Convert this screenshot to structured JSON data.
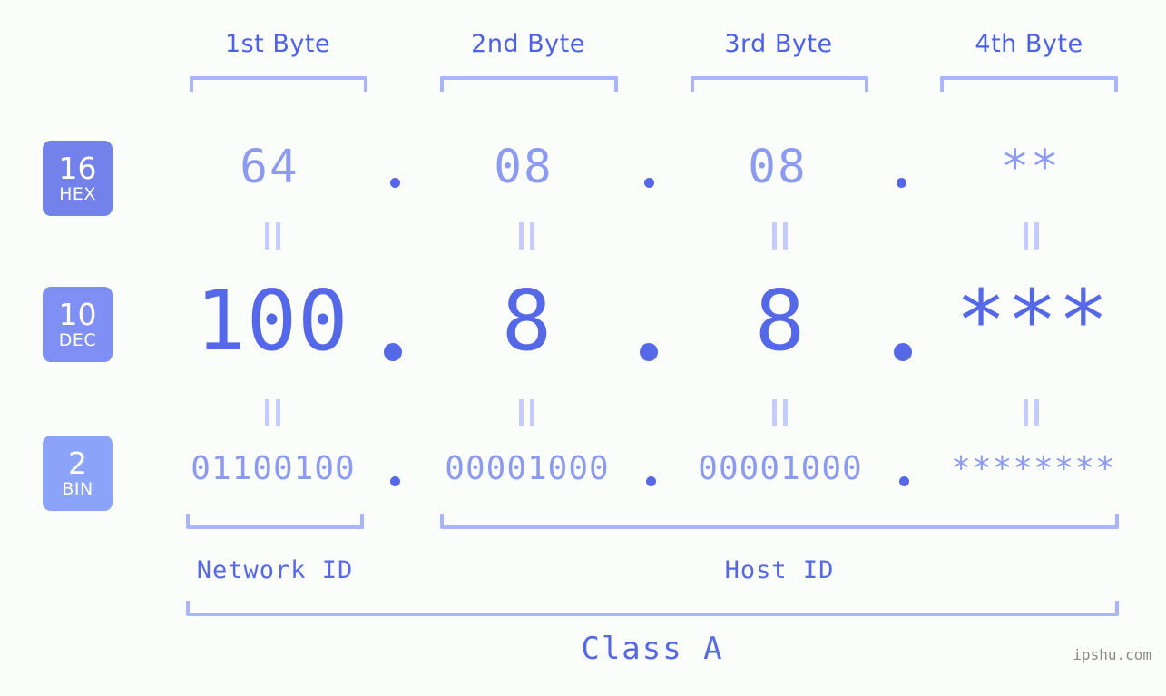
{
  "bytes": [
    {
      "header": "1st Byte"
    },
    {
      "header": "2nd Byte"
    },
    {
      "header": "3rd Byte"
    },
    {
      "header": "4th Byte"
    }
  ],
  "rows": [
    {
      "base_number": "16",
      "base_name": "HEX",
      "values": [
        "64",
        "08",
        "08",
        "**"
      ]
    },
    {
      "base_number": "10",
      "base_name": "DEC",
      "values": [
        "100",
        "8",
        "8",
        "***"
      ]
    },
    {
      "base_number": "2",
      "base_name": "BIN",
      "values": [
        "01100100",
        "00001000",
        "00001000",
        "********"
      ]
    }
  ],
  "separator": ".",
  "equals_mark": "=",
  "regions": {
    "network_id": "Network ID",
    "host_id": "Host ID"
  },
  "class_label": "Class A",
  "watermark": "ipshu.com",
  "colors": {
    "background": "#fbfdfa",
    "header_text": "#4d61e8",
    "bracket": "#aab6fb",
    "badge_hex": "#7382ea",
    "badge_dec": "#808ff3",
    "badge_bin": "#8ba3f9",
    "value_light": "#8c9bf0",
    "value_strong": "#5568e8",
    "equals_mark": "#c3ccfc",
    "watermark": "#8a8a8a"
  }
}
